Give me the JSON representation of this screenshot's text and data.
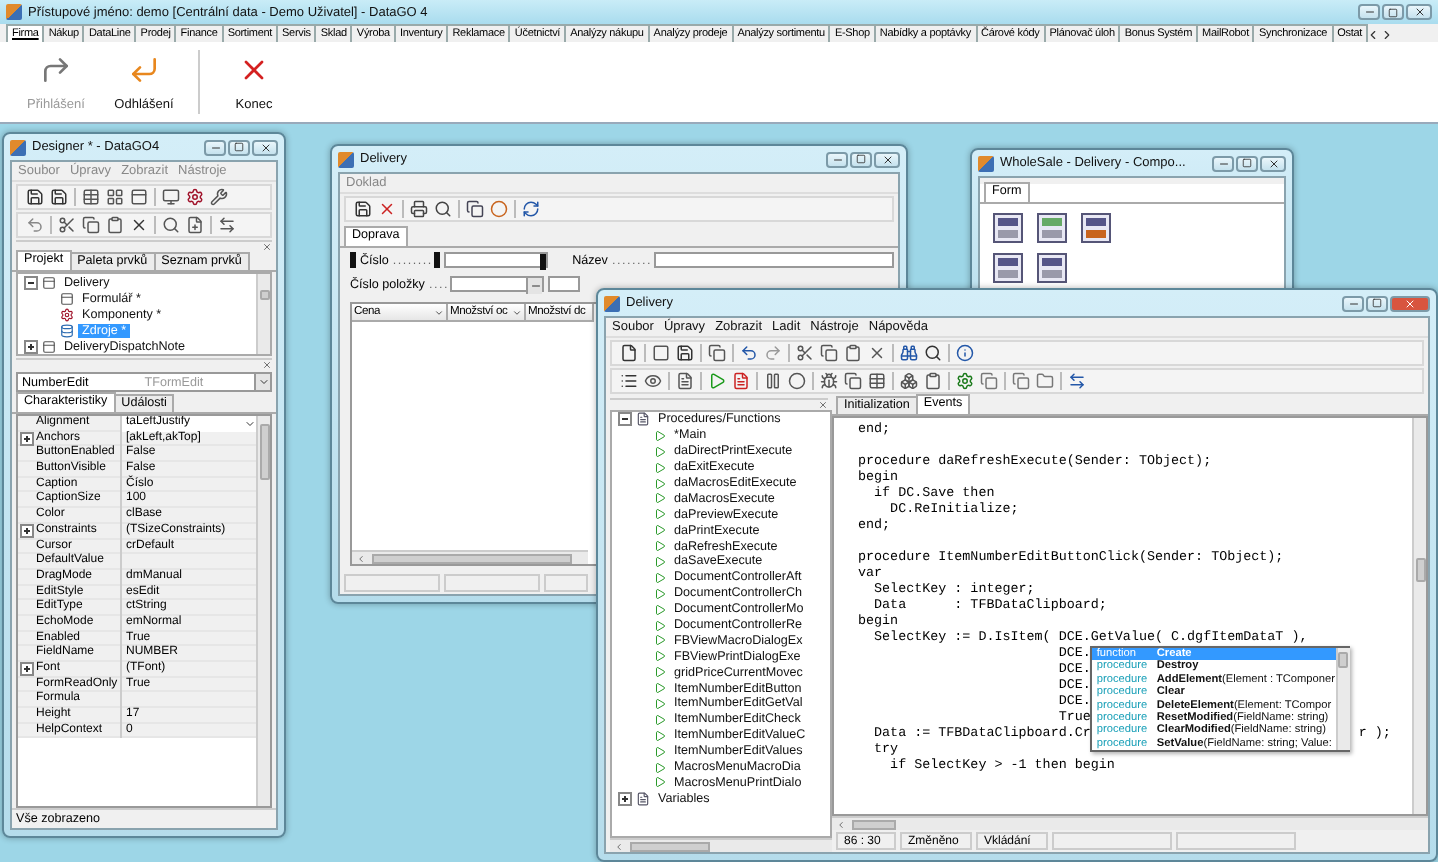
{
  "app": {
    "title": "Přístupové jméno: demo [Centrální data - Demo Uživatel] - DataGO 4",
    "tabs": [
      {
        "label": "Firma",
        "selected": true
      },
      {
        "label": "Nákup",
        "selected": false
      },
      {
        "label": "DataLine",
        "selected": false
      },
      {
        "label": "Prodej",
        "selected": false
      },
      {
        "label": "Finance",
        "selected": false
      },
      {
        "label": "Sortiment",
        "selected": false
      },
      {
        "label": "Servis",
        "selected": false
      },
      {
        "label": "Sklad",
        "selected": false
      },
      {
        "label": "Výroba",
        "selected": false
      },
      {
        "label": "Inventury",
        "selected": false
      },
      {
        "label": "Reklamace",
        "selected": false
      },
      {
        "label": "Účetnictví",
        "selected": false
      },
      {
        "label": "Analýzy nákupu",
        "selected": false
      },
      {
        "label": "Analýzy prodeje",
        "selected": false
      },
      {
        "label": "Analýzy sortimentu",
        "selected": false
      },
      {
        "label": "E-Shop",
        "selected": false
      },
      {
        "label": "Nabídky a poptávky",
        "selected": false
      },
      {
        "label": "Čárové kódy",
        "selected": false
      },
      {
        "label": "Plánovač úloh",
        "selected": false
      },
      {
        "label": "Bonus Systém",
        "selected": false
      },
      {
        "label": "MailRobot",
        "selected": false
      },
      {
        "label": "Synchronizace",
        "selected": false
      },
      {
        "label": "Ostat",
        "selected": false
      }
    ],
    "ribbon": [
      {
        "kind": "login",
        "label": "Přihlášení",
        "disabled": true
      },
      {
        "kind": "logout",
        "label": "Odhlášení",
        "disabled": false
      },
      {
        "kind": "exit",
        "label": "Konec",
        "disabled": false
      }
    ]
  },
  "designer": {
    "title": "Designer * - DataGO4",
    "menu": [
      {
        "label": "Soubor",
        "disabled": true
      },
      {
        "label": "Úpravy",
        "disabled": true
      },
      {
        "label": "Zobrazit",
        "disabled": true
      },
      {
        "label": "Nástroje",
        "disabled": true
      }
    ],
    "panel_tabs": [
      {
        "label": "Projekt",
        "selected": true
      },
      {
        "label": "Paleta prvků",
        "selected": false
      },
      {
        "label": "Seznam prvků",
        "selected": false
      }
    ],
    "tree": [
      {
        "kind": "form",
        "label": "Delivery",
        "expanded": true,
        "selected": false,
        "children": [
          {
            "kind": "form",
            "label": "Formulář *",
            "selected": false
          },
          {
            "kind": "components",
            "label": "Komponenty *",
            "selected": false
          },
          {
            "kind": "sources",
            "label": "Zdroje *",
            "selected": true
          }
        ]
      },
      {
        "kind": "form",
        "label": "DeliveryDispatchNote",
        "expanded": false,
        "selected": false
      }
    ],
    "component": {
      "name": "NumberEdit",
      "type": "TFormEdit"
    },
    "inspector_tabs": [
      {
        "label": "Charakteristiky",
        "selected": true
      },
      {
        "label": "Události",
        "selected": false
      }
    ],
    "properties": [
      {
        "name": "Alignment",
        "value": "taLeftJustify",
        "expandable": false,
        "selected": true
      },
      {
        "name": "Anchors",
        "value": "[akLeft,akTop]",
        "expandable": true,
        "selected": false
      },
      {
        "name": "ButtonEnabled",
        "value": "False",
        "expandable": false,
        "selected": false
      },
      {
        "name": "ButtonVisible",
        "value": "False",
        "expandable": false,
        "selected": false
      },
      {
        "name": "Caption",
        "value": "Číslo",
        "expandable": false,
        "selected": false
      },
      {
        "name": "CaptionSize",
        "value": "100",
        "expandable": false,
        "selected": false
      },
      {
        "name": "Color",
        "value": "clBase",
        "expandable": false,
        "selected": false
      },
      {
        "name": "Constraints",
        "value": "(TSizeConstraints)",
        "expandable": true,
        "selected": false
      },
      {
        "name": "Cursor",
        "value": "crDefault",
        "expandable": false,
        "selected": false
      },
      {
        "name": "DefaultValue",
        "expandable": false,
        "selected": false
      },
      {
        "name": "DragMode",
        "value": "dmManual",
        "expandable": false,
        "selected": false
      },
      {
        "name": "EditStyle",
        "value": "esEdit",
        "expandable": false,
        "selected": false
      },
      {
        "name": "EditType",
        "value": "ctString",
        "expandable": false,
        "selected": false
      },
      {
        "name": "EchoMode",
        "value": "emNormal",
        "expandable": false,
        "selected": false
      },
      {
        "name": "Enabled",
        "value": "True",
        "expandable": false,
        "selected": false
      },
      {
        "name": "FieldName",
        "value": "NUMBER",
        "expandable": false,
        "selected": false
      },
      {
        "name": "Font",
        "value": "(TFont)",
        "expandable": true,
        "selected": false
      },
      {
        "name": "FormReadOnly",
        "value": "True",
        "expandable": false,
        "selected": false
      },
      {
        "name": "Formula",
        "expandable": false,
        "selected": false
      },
      {
        "name": "Height",
        "value": "17",
        "expandable": false,
        "selected": false
      },
      {
        "name": "HelpContext",
        "value": "0",
        "expandable": false,
        "selected": false
      }
    ],
    "status": "Vše zobrazeno"
  },
  "delivery": {
    "title": "Delivery",
    "menu": [
      {
        "label": "Doklad",
        "disabled": true
      }
    ],
    "tabs": [
      {
        "label": "Doprava",
        "selected": true
      }
    ],
    "fields": [
      {
        "label": "Číslo",
        "leader": ". . . . . . . ."
      },
      {
        "label": "Název",
        "leader": ". . . . . . . ."
      },
      {
        "label": "Číslo položky",
        "leader": ". . . ."
      }
    ],
    "columns": [
      "Cena",
      "Množství oc",
      "Množství dc"
    ]
  },
  "wholesale": {
    "title": "WholeSale - Delivery - Compo...",
    "tabs": [
      {
        "label": "Form",
        "selected": true
      }
    ]
  },
  "editor": {
    "title": "Delivery",
    "menu": [
      {
        "label": "Soubor",
        "disabled": false
      },
      {
        "label": "Úpravy",
        "disabled": false
      },
      {
        "label": "Zobrazit",
        "disabled": false
      },
      {
        "label": "Ladit",
        "disabled": false
      },
      {
        "label": "Nástroje",
        "disabled": false
      },
      {
        "label": "Nápověda",
        "disabled": false
      }
    ],
    "tree": [
      {
        "kind": "folder",
        "label": "Procedures/Functions",
        "expanded": true,
        "selected": false,
        "children": [
          {
            "kind": "procedure",
            "label": "*Main",
            "selected": false
          },
          {
            "kind": "procedure",
            "label": "daDirectPrintExecute",
            "selected": false
          },
          {
            "kind": "procedure",
            "label": "daExitExecute",
            "selected": false
          },
          {
            "kind": "procedure",
            "label": "daMacrosEditExecute",
            "selected": false
          },
          {
            "kind": "procedure",
            "label": "daMacrosExecute",
            "selected": false
          },
          {
            "kind": "procedure",
            "label": "daPreviewExecute",
            "selected": false
          },
          {
            "kind": "procedure",
            "label": "daPrintExecute",
            "selected": false
          },
          {
            "kind": "procedure",
            "label": "daRefreshExecute",
            "selected": false
          },
          {
            "kind": "procedure",
            "label": "daSaveExecute",
            "selected": false
          },
          {
            "kind": "procedure",
            "label": "DocumentControllerAft",
            "selected": false
          },
          {
            "kind": "procedure",
            "label": "DocumentControllerCh",
            "selected": false
          },
          {
            "kind": "procedure",
            "label": "DocumentControllerMo",
            "selected": false
          },
          {
            "kind": "procedure",
            "label": "DocumentControllerRe",
            "selected": false
          },
          {
            "kind": "procedure",
            "label": "FBViewMacroDialogEx",
            "selected": false
          },
          {
            "kind": "procedure",
            "label": "FBViewPrintDialogExe",
            "selected": false
          },
          {
            "kind": "procedure",
            "label": "gridPriceCurrentMovec",
            "selected": false
          },
          {
            "kind": "procedure",
            "label": "ItemNumberEditButton",
            "selected": false
          },
          {
            "kind": "procedure",
            "label": "ItemNumberEditGetVal",
            "selected": false
          },
          {
            "kind": "procedure",
            "label": "ItemNumberEditCheck",
            "selected": false
          },
          {
            "kind": "procedure",
            "label": "ItemNumberEditValueC",
            "selected": false
          },
          {
            "kind": "procedure",
            "label": "ItemNumberEditValues",
            "selected": false
          },
          {
            "kind": "procedure",
            "label": "MacrosMenuMacroDia",
            "selected": false
          },
          {
            "kind": "procedure",
            "label": "MacrosMenuPrintDialo",
            "selected": false
          }
        ]
      },
      {
        "kind": "folder",
        "label": "Variables",
        "expanded": false,
        "selected": false
      }
    ],
    "tabs": [
      {
        "label": "Initialization",
        "selected": false
      },
      {
        "label": "Events",
        "selected": true
      }
    ],
    "code": [
      {
        "kind": "code",
        "text": "end;"
      },
      {
        "kind": "blank"
      },
      {
        "kind": "code",
        "text": "procedure daRefreshExecute(Sender: TObject);"
      },
      {
        "kind": "code",
        "text": "begin"
      },
      {
        "kind": "code",
        "text": "  if DC.Save then"
      },
      {
        "kind": "code",
        "text": "    DC.ReInitialize;"
      },
      {
        "kind": "code",
        "text": "end;"
      },
      {
        "kind": "blank"
      },
      {
        "kind": "code",
        "text": "procedure ItemNumberEditButtonClick(Sender: TObject);"
      },
      {
        "kind": "code",
        "text": "var"
      },
      {
        "kind": "code",
        "text": "  SelectKey : integer;"
      },
      {
        "kind": "code",
        "text": "  Data      : TFBDataClipboard;"
      },
      {
        "kind": "code",
        "text": "begin"
      },
      {
        "kind": "code",
        "text": "  SelectKey := D.IsItem( DCE.GetValue( C.dgfItemDataT ),"
      },
      {
        "kind": "code",
        "text": "                         DCE."
      },
      {
        "kind": "code",
        "text": "                         DCE."
      },
      {
        "kind": "code",
        "text": "                         DCE."
      },
      {
        "kind": "code",
        "text": "                         DCE."
      },
      {
        "kind": "code",
        "text": "                         True"
      },
      {
        "kind": "code",
        "text": "  Data := TFBDataClipboard.Cr",
        "tail": "r );"
      },
      {
        "kind": "code",
        "text": "  try"
      },
      {
        "kind": "code",
        "text": "    if SelectKey > -1 then begin"
      }
    ],
    "completion": [
      {
        "type": "function",
        "name": "Create",
        "selected": true
      },
      {
        "type": "procedure",
        "name": "Destroy",
        "selected": false
      },
      {
        "type": "procedure",
        "name": "AddElement",
        "params": "(Element : TComponer",
        "selected": false
      },
      {
        "type": "procedure",
        "name": "Clear",
        "selected": false
      },
      {
        "type": "procedure",
        "name": "DeleteElement",
        "params": "(Element: TCompor",
        "selected": false
      },
      {
        "type": "procedure",
        "name": "ResetModified",
        "params": "(FieldName: string)",
        "selected": false
      },
      {
        "type": "procedure",
        "name": "ClearModified",
        "params": "(FieldName: string)",
        "selected": false
      },
      {
        "type": "procedure",
        "name": "SetValue",
        "params": "(FieldName: string; Value:",
        "selected": false
      }
    ],
    "status": [
      "86 : 30",
      "Změněno",
      "Vkládání"
    ]
  }
}
